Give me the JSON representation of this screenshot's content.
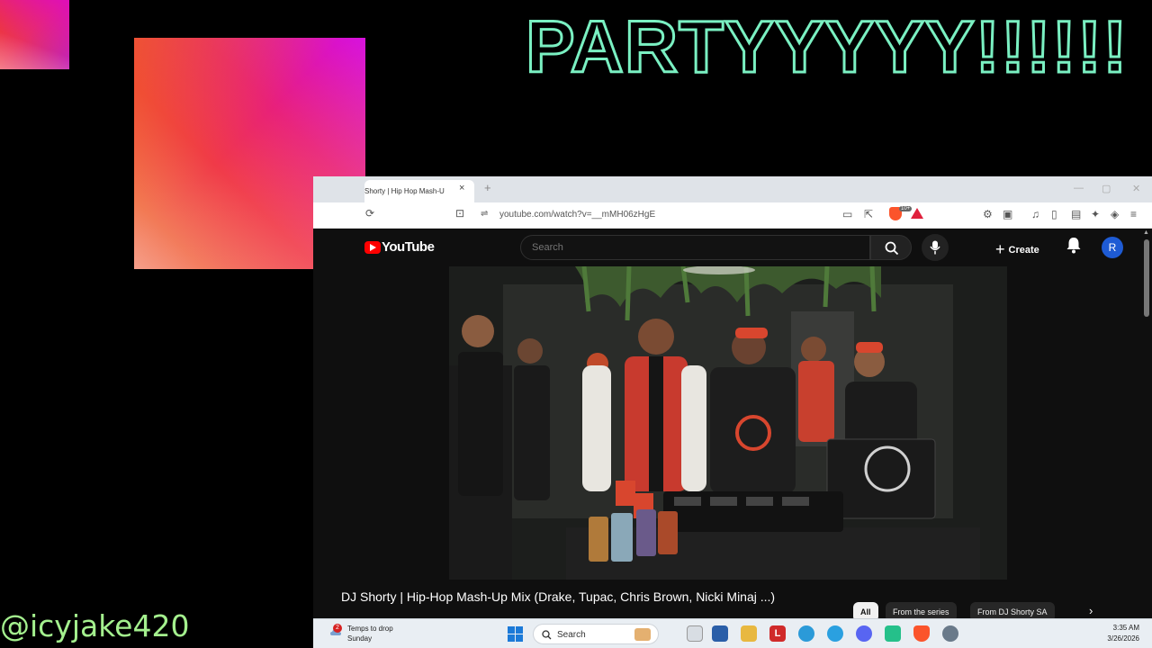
{
  "overlay": {
    "headline": "PARTYYYYY!!!!!!",
    "handle": "@icyjake420"
  },
  "browser": {
    "tab_title": "Shorty | Hip Hop Mash-U",
    "url": "youtube.com/watch?v=__mMH06zHgE",
    "brave_shield_count": "10+"
  },
  "youtube": {
    "logo_text": "YouTube",
    "search_placeholder": "Search",
    "create_label": "Create",
    "avatar_initial": "R",
    "video_title": "DJ Shorty | Hip-Hop Mash-Up Mix (Drake, Tupac, Chris Brown, Nicki Minaj ...)",
    "chips": [
      {
        "label": "All",
        "active": true
      },
      {
        "label": "From the series",
        "active": false
      },
      {
        "label": "From DJ Shorty SA",
        "active": false
      }
    ]
  },
  "taskbar": {
    "weather_badge": "2",
    "weather_line1": "Temps to drop",
    "weather_line2": "Sunday",
    "search_label": "Search",
    "time": "3:35 AM",
    "date": "3/26/2026"
  },
  "colors": {
    "headline_outline": "#7af0c2",
    "handle": "#a4f08e",
    "youtube_red": "#ff0000",
    "avatar_bg": "#1e5bd4"
  }
}
